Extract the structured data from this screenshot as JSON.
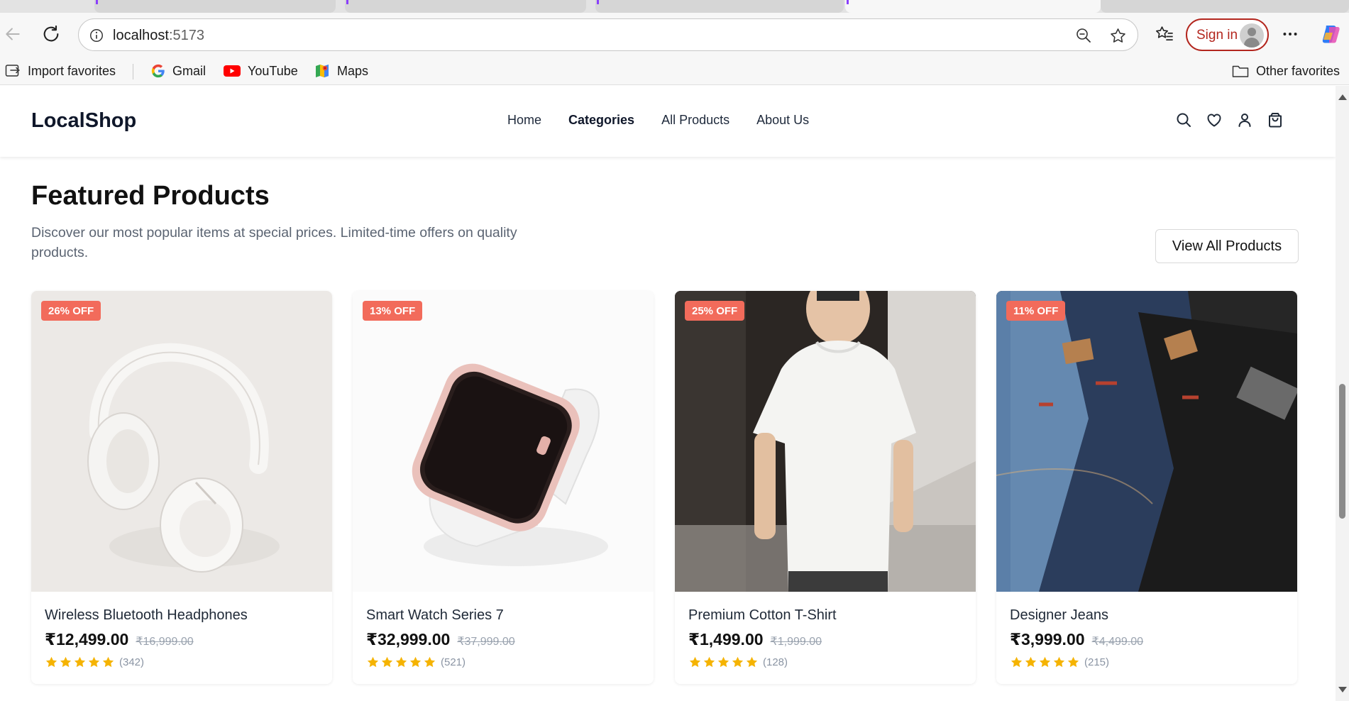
{
  "browser": {
    "url_host": "localhost",
    "url_port": ":5173",
    "signin_label": "Sign in",
    "icons": [
      "back-icon",
      "reload-icon",
      "info-icon",
      "zoom-out-icon",
      "favorite-star-icon",
      "favorites-list-icon",
      "more-icon",
      "copilot-icon"
    ]
  },
  "favorites": {
    "import_label": "Import favorites",
    "items": [
      {
        "label": "Gmail",
        "icon": "gmail-icon"
      },
      {
        "label": "YouTube",
        "icon": "youtube-icon"
      },
      {
        "label": "Maps",
        "icon": "maps-icon"
      }
    ],
    "other_label": "Other favorites"
  },
  "site": {
    "logo": "LocalShop",
    "nav": [
      {
        "label": "Home"
      },
      {
        "label": "Categories",
        "active": true
      },
      {
        "label": "All Products"
      },
      {
        "label": "About Us"
      }
    ],
    "header_icons": [
      "search-icon",
      "heart-icon",
      "user-icon",
      "shopping-bag-icon"
    ]
  },
  "featured": {
    "title": "Featured Products",
    "subtitle": "Discover our most popular items at special prices. Limited-time offers on quality products.",
    "view_all_label": "View All Products"
  },
  "products": [
    {
      "discount": "26% OFF",
      "name": "Wireless Bluetooth Headphones",
      "price": "₹12,499.00",
      "old_price": "₹16,999.00",
      "rating": 5,
      "reviews": "(342)",
      "image": "white-headphones"
    },
    {
      "discount": "13% OFF",
      "name": "Smart Watch Series 7",
      "price": "₹32,999.00",
      "old_price": "₹37,999.00",
      "rating": 5,
      "reviews": "(521)",
      "image": "rose-gold-smartwatch"
    },
    {
      "discount": "25% OFF",
      "name": "Premium Cotton T-Shirt",
      "price": "₹1,499.00",
      "old_price": "₹1,999.00",
      "rating": 5,
      "reviews": "(128)",
      "image": "man-in-white-tshirt"
    },
    {
      "discount": "11% OFF",
      "name": "Designer Jeans",
      "price": "₹3,999.00",
      "old_price": "₹4,499.00",
      "rating": 5,
      "reviews": "(215)",
      "image": "stacked-jeans"
    }
  ],
  "colors": {
    "badge": "#f26b5b",
    "star": "#f5b301",
    "signin_accent": "#b3261e"
  }
}
